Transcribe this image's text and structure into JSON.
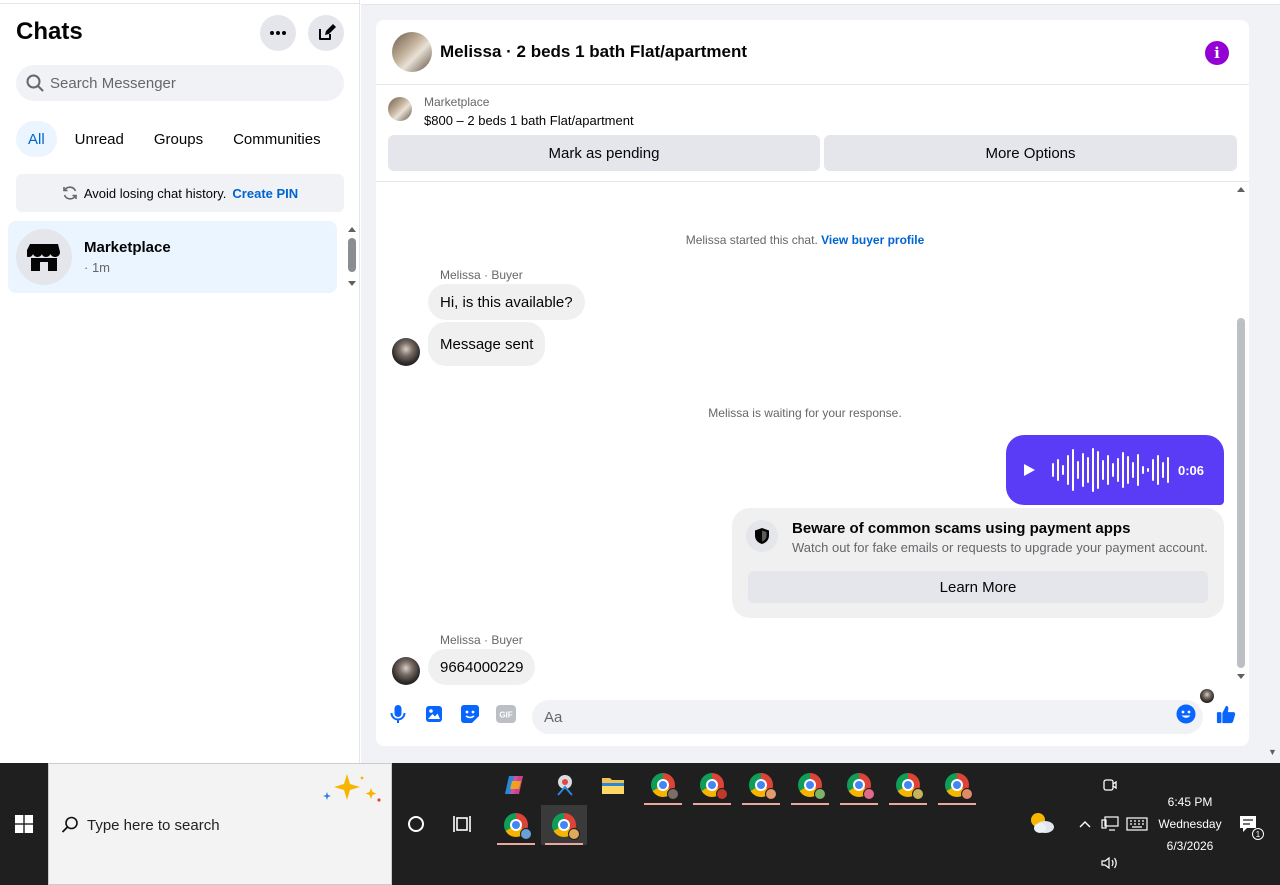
{
  "sidebar": {
    "title": "Chats",
    "search_placeholder": "Search Messenger",
    "filters": [
      "All",
      "Unread",
      "Groups",
      "Communities"
    ],
    "pin_banner": {
      "text": "Avoid losing chat history.",
      "link": "Create PIN"
    },
    "chats": [
      {
        "name": "Marketplace",
        "time": "· 1m"
      }
    ]
  },
  "conversation": {
    "title": "Melissa · 2 beds 1 bath Flat/apartment",
    "listing": {
      "source": "Marketplace",
      "title": "$800 – 2 beds 1 bath Flat/apartment",
      "mark_pending_label": "Mark as pending",
      "more_options_label": "More Options"
    },
    "started_note": {
      "text": "Melissa started this chat.",
      "link": "View buyer profile"
    },
    "sender_label": "Melissa · Buyer",
    "messages_in_1": [
      "Hi, is this available?",
      "Message sent"
    ],
    "waiting_note": "Melissa is waiting for your response.",
    "voice_duration": "0:06",
    "scam_card": {
      "title": "Beware of common scams using payment apps",
      "body": "Watch out for fake emails or requests to upgrade your payment account.",
      "button": "Learn More"
    },
    "messages_in_2": [
      "9664000229"
    ],
    "composer_placeholder": "Aa",
    "accent_color": "#0866ff",
    "voice_color": "#5b3cf6"
  },
  "taskbar": {
    "search_placeholder": "Type here to search",
    "time": "6:45 PM",
    "day": "Wednesday",
    "date": "6/3/2026",
    "notification_count": "1"
  }
}
